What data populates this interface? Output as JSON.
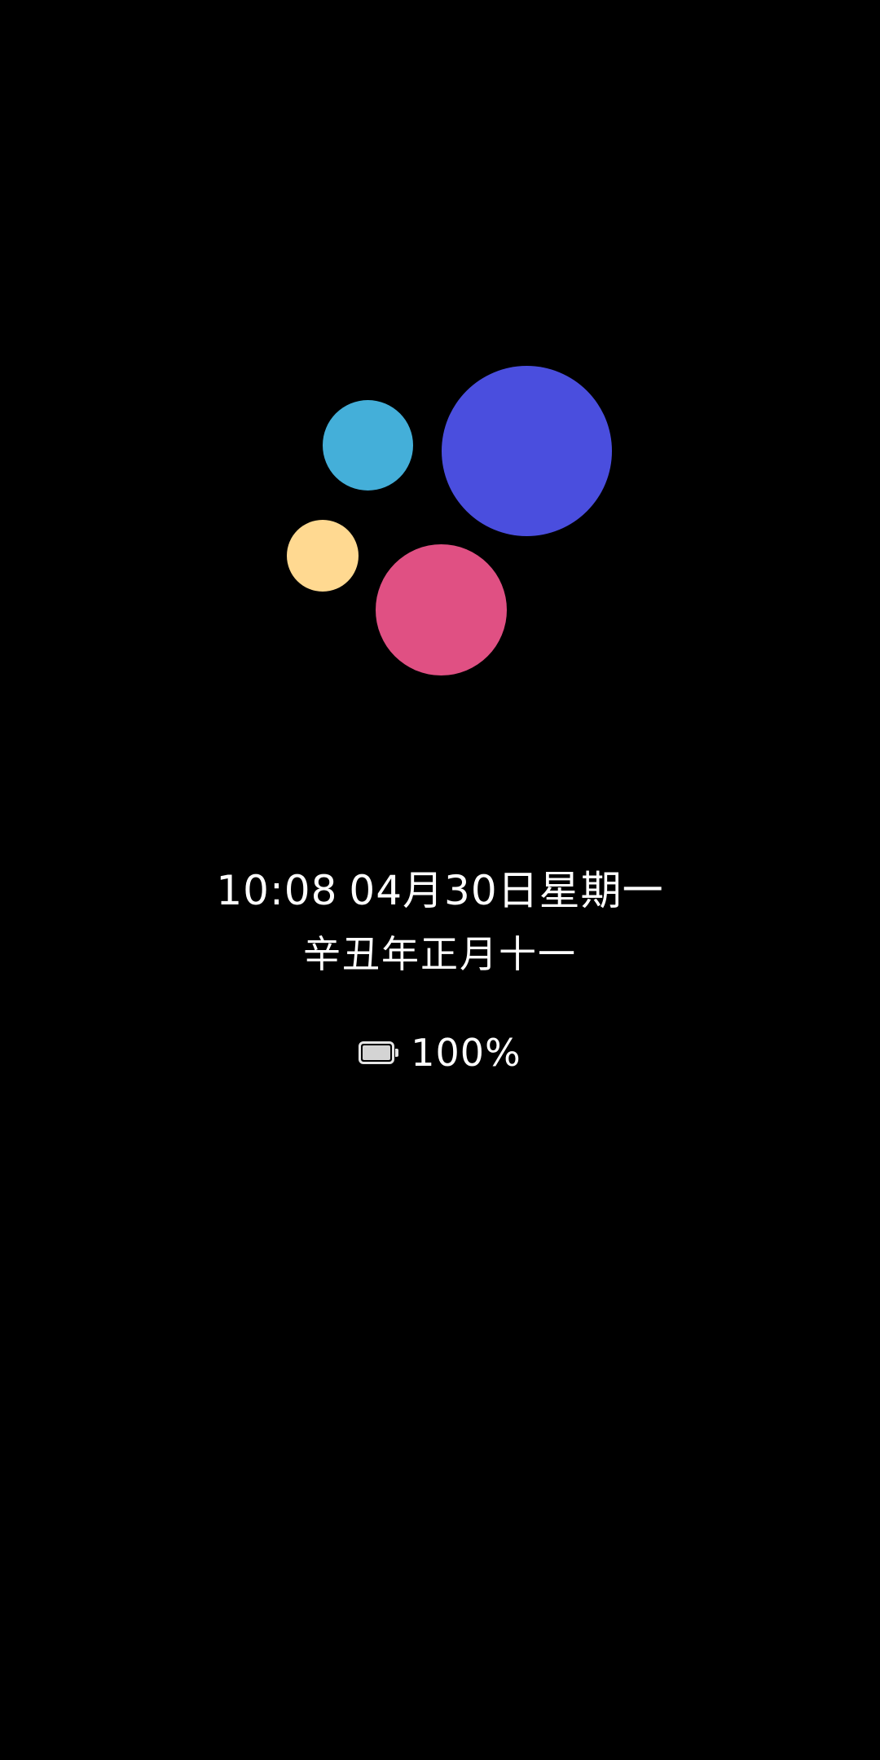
{
  "colors": {
    "background": "#000000",
    "text": "#ffffff",
    "bubble_blue": "#4a4ede",
    "bubble_cyan": "#44afd9",
    "bubble_yellow": "#ffd991",
    "bubble_pink": "#e05083"
  },
  "aod": {
    "time": "10:08",
    "date": "04月30日星期一",
    "lunar_date": "辛丑年正月十一",
    "battery": {
      "icon": "battery-icon",
      "level_fraction": 1.0,
      "text": "100%"
    }
  }
}
